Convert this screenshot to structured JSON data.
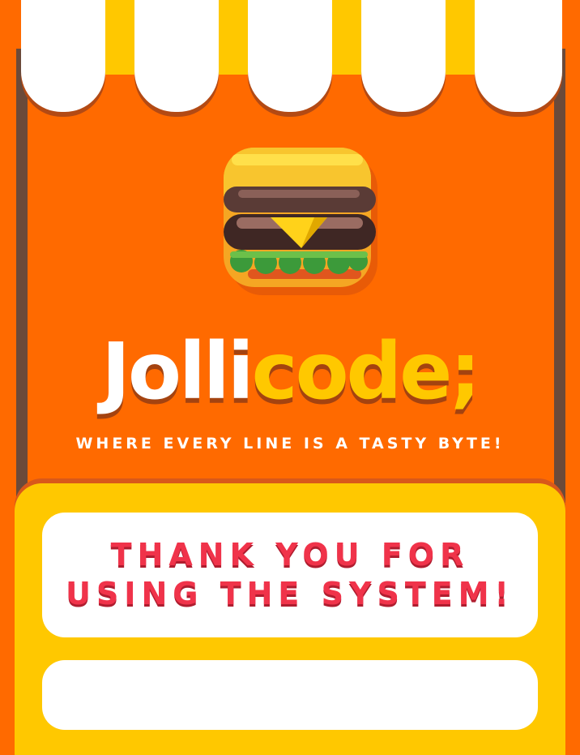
{
  "brand": {
    "name_part1": "Jolli",
    "name_part2": "code;",
    "tagline": "WHERE EVERY LINE IS A TASTY BYTE!"
  },
  "message": {
    "line1": "THANK YOU FOR",
    "line2": "USING THE SYSTEM!"
  },
  "colors": {
    "background": "#ff6a00",
    "accent_yellow": "#ffc800",
    "message_red": "#f0334a",
    "white": "#ffffff"
  },
  "icons": {
    "logo": "burger-icon"
  }
}
